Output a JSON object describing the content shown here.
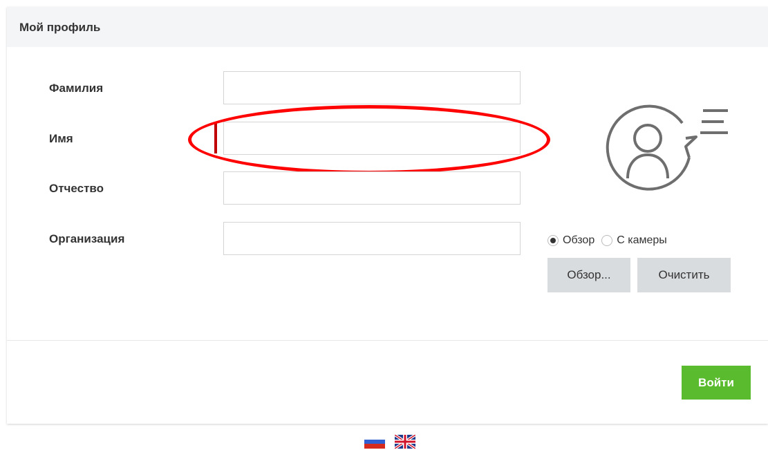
{
  "header": {
    "title": "Мой профиль"
  },
  "form": {
    "last_name": {
      "label": "Фамилия",
      "value": "",
      "placeholder": ""
    },
    "first_name": {
      "label": "Имя",
      "value": "",
      "placeholder": ""
    },
    "patronymic": {
      "label": "Отчество",
      "value": "",
      "placeholder": ""
    },
    "organization": {
      "label": "Организация",
      "value": "",
      "placeholder": ""
    }
  },
  "photo": {
    "icon": "user-profile-icon",
    "options": [
      {
        "label": "Обзор",
        "checked": true
      },
      {
        "label": "С камеры",
        "checked": false
      }
    ],
    "browse_label": "Обзор...",
    "clear_label": "Очистить"
  },
  "footer": {
    "login_label": "Войти"
  },
  "languages": [
    {
      "code": "ru",
      "icon": "russia-flag-icon"
    },
    {
      "code": "en",
      "icon": "uk-flag-icon"
    }
  ],
  "colors": {
    "accent_green": "#5bbb2e",
    "highlight_red": "#ff0000",
    "header_bg": "#f4f5f7",
    "button_gray": "#d9dcdf"
  }
}
